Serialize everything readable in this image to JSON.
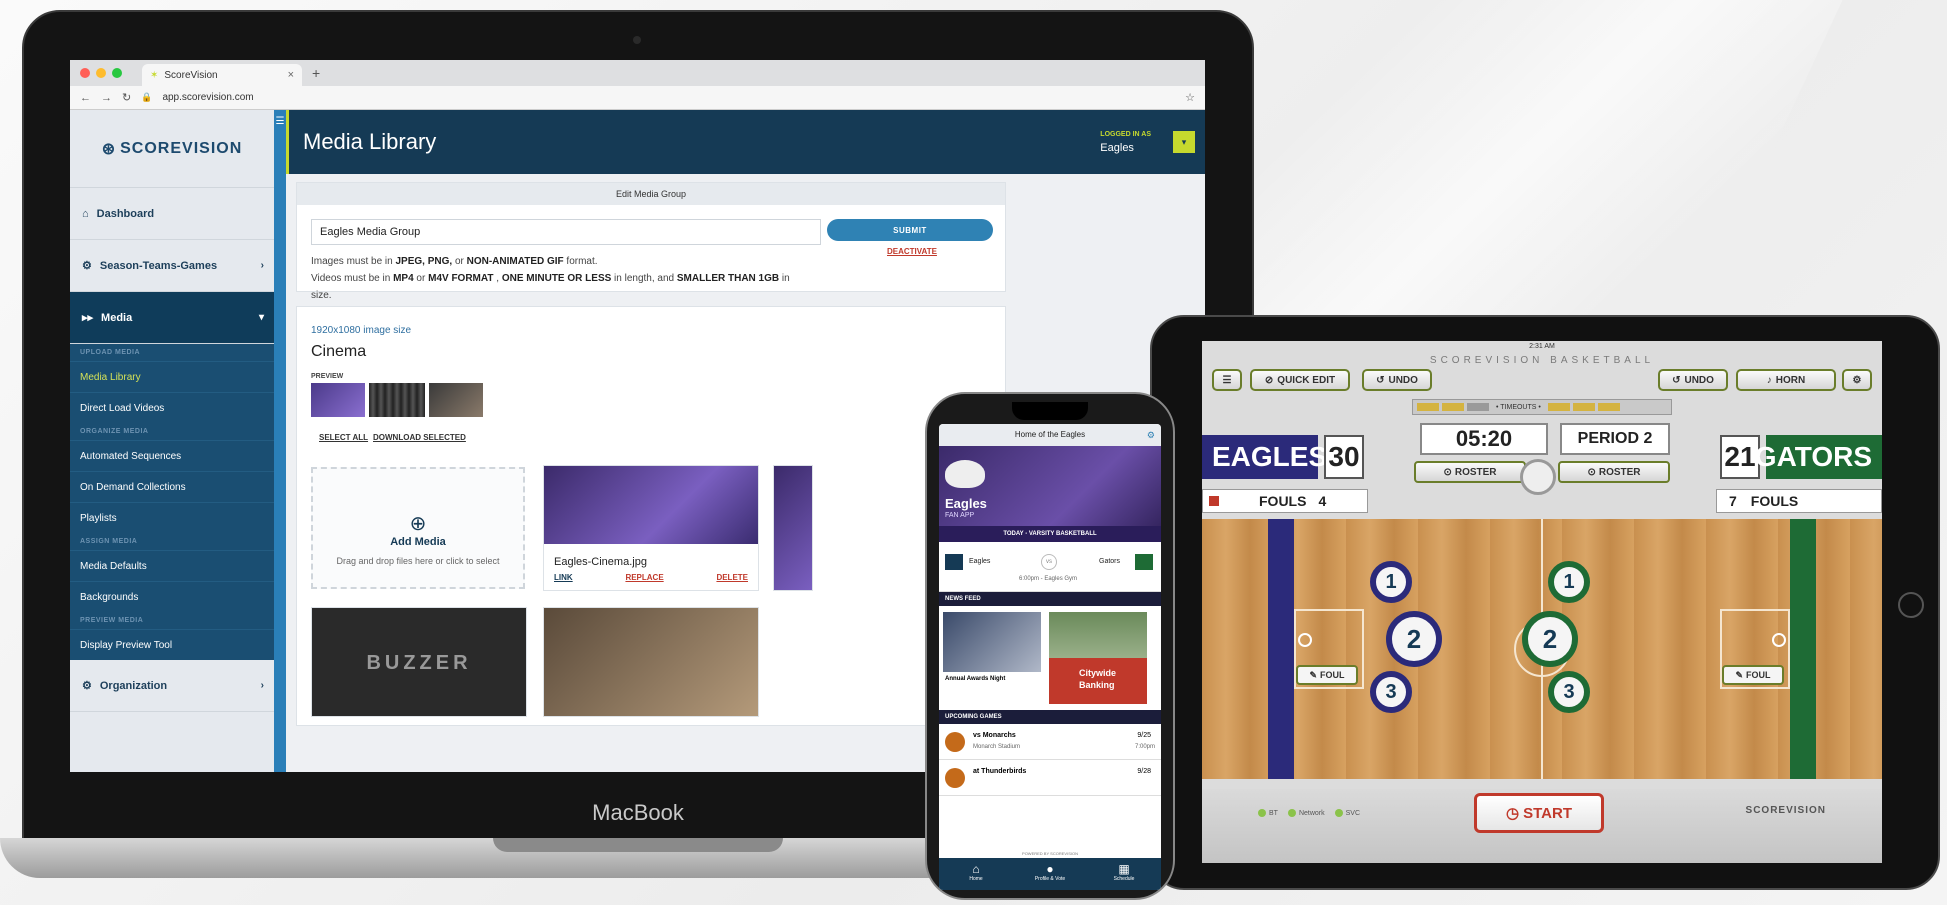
{
  "laptop": {
    "brand": "MacBook",
    "browser": {
      "tab_title": "ScoreVision",
      "tab_close": "×",
      "new_tab": "+",
      "url": "app.scorevision.com"
    },
    "app": {
      "logo": "SCOREVISION",
      "sidebar": {
        "items": [
          {
            "label": "Dashboard",
            "icon": "home-icon"
          },
          {
            "label": "Season-Teams-Games",
            "icon": "trophy-icon"
          },
          {
            "label": "Media",
            "icon": "media-icon"
          },
          {
            "label": "Organization",
            "icon": "gear-icon"
          }
        ],
        "media_sections": [
          {
            "heading": "UPLOAD MEDIA",
            "items": [
              "Media Library",
              "Direct Load Videos"
            ]
          },
          {
            "heading": "ORGANIZE MEDIA",
            "items": [
              "Automated Sequences",
              "On Demand Collections",
              "Playlists"
            ]
          },
          {
            "heading": "ASSIGN MEDIA",
            "items": [
              "Media Defaults",
              "Backgrounds"
            ]
          },
          {
            "heading": "PREVIEW MEDIA",
            "items": [
              "Display Preview Tool"
            ]
          }
        ]
      },
      "header": {
        "title": "Media Library",
        "logged_in_label": "LOGGED IN AS",
        "user": "Eagles"
      },
      "edit_group": {
        "heading": "Edit Media Group",
        "name_value": "Eagles Media Group",
        "submit": "SUBMIT",
        "deactivate": "DEACTIVATE",
        "note1_pre": "Images must be in ",
        "note1_b1": "JPEG, PNG,",
        "note1_mid": " or ",
        "note1_b2": "NON-ANIMATED GIF",
        "note1_post": " format.",
        "note2_pre": "Videos must be in ",
        "note2_b1": "MP4",
        "note2_mid1": " or ",
        "note2_b2": "M4V FORMAT",
        "note2_mid2": " , ",
        "note2_b3": "ONE MINUTE OR LESS",
        "note2_mid3": " in length, and ",
        "note2_b4": "SMALLER THAN 1GB",
        "note2_post": " in size."
      },
      "cinema": {
        "size": "1920x1080 image size",
        "title": "Cinema",
        "preview_label": "PREVIEW",
        "select_all": "SELECT ALL",
        "download_selected": "DOWNLOAD SELECTED",
        "add_media": "Add Media",
        "add_hint": "Drag and drop files here or click to select",
        "file_name": "Eagles-Cinema.jpg",
        "link": "LINK",
        "replace": "REPLACE",
        "delete": "DELETE",
        "thumb_text": "BUZZER BEATER"
      }
    }
  },
  "phone": {
    "header": "Home of the Eagles",
    "app_name": "Eagles",
    "app_sub": "FAN APP",
    "today_label": "TODAY - VARSITY BASKETBALL",
    "home_team": "Eagles",
    "away_team": "Gators",
    "vs": "vs",
    "game_time": "6:00pm - Eagles Gym",
    "news_feed": "NEWS FEED",
    "news_caption": "Annual Awards Night",
    "sponsor_1": "Citywide",
    "sponsor_2": "Banking",
    "upcoming": "UPCOMING GAMES",
    "games": [
      {
        "opponent": "vs Monarchs",
        "venue": "Monarch Stadium",
        "date": "9/25",
        "time": "7:00pm"
      },
      {
        "opponent": "at Thunderbirds",
        "venue": "",
        "date": "9/28",
        "time": ""
      }
    ],
    "powered": "POWERED BY SCOREVISION",
    "tabs": [
      {
        "label": "Home",
        "icon": "home-icon"
      },
      {
        "label": "Profile & Vote",
        "icon": "person-icon"
      },
      {
        "label": "Schedule",
        "icon": "calendar-icon"
      }
    ]
  },
  "tablet": {
    "time": "2:31 AM",
    "title": "SCOREVISION BASKETBALL",
    "quick_edit": "QUICK EDIT",
    "undo": "UNDO",
    "horn": "HORN",
    "timeouts": "• TIMEOUTS •",
    "home": {
      "name": "EAGLES",
      "score": "30",
      "fouls": "4",
      "color": "#2b2a7a"
    },
    "away": {
      "name": "GATORS",
      "score": "21",
      "fouls": "7",
      "color": "#1e6b35"
    },
    "fouls_label": "FOULS",
    "clock": "05:20",
    "period": "PERIOD 2",
    "roster": "ROSTER",
    "foul_btn": "FOUL",
    "players_home": [
      "1",
      "2",
      "3"
    ],
    "players_away": [
      "1",
      "2",
      "3"
    ],
    "start": "START",
    "status": [
      "BT",
      "Network",
      "SVC"
    ],
    "brand_footer": "SCOREVISION"
  }
}
